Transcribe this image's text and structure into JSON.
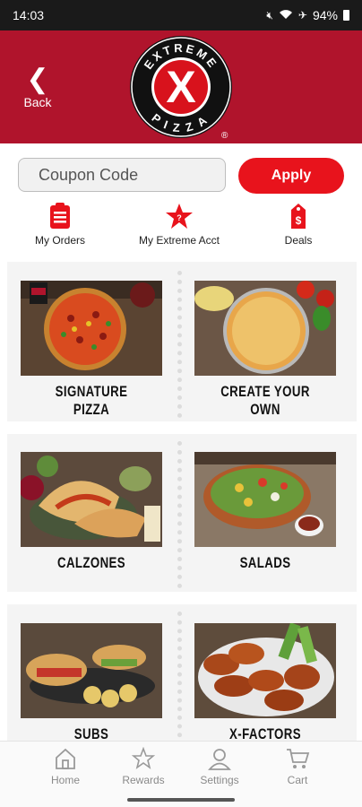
{
  "status_bar": {
    "time": "14:03",
    "battery": "94%",
    "icons": [
      "mute-icon",
      "wifi-icon",
      "airplane-icon",
      "battery-icon"
    ]
  },
  "header": {
    "back_label": "Back",
    "back_glyph": "❮",
    "logo_text_top": "EXTREME",
    "logo_text_bottom": "PIZZA",
    "logo_letter": "X",
    "logo_mark": "®",
    "brand_color": "#b0142c"
  },
  "coupon": {
    "placeholder": "Coupon Code",
    "value": "",
    "apply_label": "Apply",
    "apply_color": "#e8131c"
  },
  "quick_links": [
    {
      "label": "My Orders",
      "icon": "clipboard-icon"
    },
    {
      "label": "My Extreme Acct",
      "icon": "star-icon"
    },
    {
      "label": "Deals",
      "icon": "price-tag-icon"
    }
  ],
  "menu": [
    {
      "label": "SIGNATURE PIZZA"
    },
    {
      "label": "CREATE YOUR OWN"
    },
    {
      "label": "CALZONES"
    },
    {
      "label": "SALADS"
    },
    {
      "label": "SUBS"
    },
    {
      "label": "X-FACTORS"
    }
  ],
  "bottom_nav": [
    {
      "label": "Home",
      "icon": "home-icon"
    },
    {
      "label": "Rewards",
      "icon": "star-outline-icon"
    },
    {
      "label": "Settings",
      "icon": "person-icon"
    },
    {
      "label": "Cart",
      "icon": "cart-icon"
    }
  ]
}
